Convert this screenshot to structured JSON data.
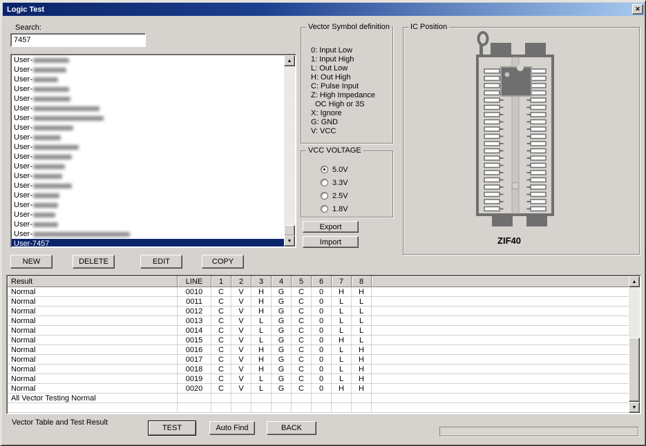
{
  "window": {
    "title": "Logic Test"
  },
  "icons": {
    "close": "✕",
    "scroll_up": "▲",
    "scroll_down": "▼"
  },
  "search": {
    "label": "Search:",
    "value": "7457"
  },
  "device_list": {
    "items": [
      {
        "label": "User-",
        "redacted": true,
        "blur_width": 52
      },
      {
        "label": "User-",
        "redacted": true,
        "blur_width": 48
      },
      {
        "label": "User-",
        "redacted": true,
        "blur_width": 36
      },
      {
        "label": "User-",
        "redacted": true,
        "blur_width": 52
      },
      {
        "label": "User-",
        "redacted": true,
        "blur_width": 54
      },
      {
        "label": "User-",
        "redacted": true,
        "blur_width": 96
      },
      {
        "label": "User-",
        "redacted": true,
        "blur_width": 102
      },
      {
        "label": "User-",
        "redacted": true,
        "blur_width": 58
      },
      {
        "label": "User-",
        "redacted": true,
        "blur_width": 40
      },
      {
        "label": "User-",
        "redacted": true,
        "blur_width": 66
      },
      {
        "label": "User-",
        "redacted": true,
        "blur_width": 56
      },
      {
        "label": "User-",
        "redacted": true,
        "blur_width": 46
      },
      {
        "label": "User-",
        "redacted": true,
        "blur_width": 42
      },
      {
        "label": "User-",
        "redacted": true,
        "blur_width": 56
      },
      {
        "label": "User-",
        "redacted": true,
        "blur_width": 38
      },
      {
        "label": "User-",
        "redacted": true,
        "blur_width": 36
      },
      {
        "label": "User-",
        "redacted": true,
        "blur_width": 32
      },
      {
        "label": "User-",
        "redacted": true,
        "blur_width": 36
      },
      {
        "label": "User-",
        "redacted": true,
        "blur_width": 140
      },
      {
        "label": "User-7457",
        "redacted": false,
        "selected": true
      }
    ]
  },
  "list_actions": {
    "new": "NEW",
    "delete": "DELETE",
    "edit": "EDIT",
    "copy": "COPY"
  },
  "vector_symbols": {
    "title": "Vector Symbol definition",
    "lines": [
      "0: Input Low",
      "1: Input High",
      "L: Out Low",
      "H: Out High",
      "C: Pulse Input",
      "Z: High Impedance",
      "  OC High or 3S",
      "X: Ignore",
      "G: GND",
      "V: VCC"
    ]
  },
  "vcc_voltage": {
    "title": "VCC VOLTAGE",
    "options": [
      {
        "label": "5.0V",
        "selected": true
      },
      {
        "label": "3.3V",
        "selected": false
      },
      {
        "label": "2.5V",
        "selected": false
      },
      {
        "label": "1.8V",
        "selected": false
      }
    ]
  },
  "transfer": {
    "export": "Export",
    "import": "Import"
  },
  "ic_position": {
    "title": "IC Position",
    "socket": "ZIF40"
  },
  "result_table": {
    "headers": [
      "Result",
      "LINE",
      "1",
      "2",
      "3",
      "4",
      "5",
      "6",
      "7",
      "8"
    ],
    "rows": [
      {
        "result": "Normal",
        "line": "0010",
        "values": [
          "C",
          "V",
          "H",
          "G",
          "C",
          "0",
          "H",
          "H"
        ]
      },
      {
        "result": "Normal",
        "line": "0011",
        "values": [
          "C",
          "V",
          "H",
          "G",
          "C",
          "0",
          "L",
          "L"
        ]
      },
      {
        "result": "Normal",
        "line": "0012",
        "values": [
          "C",
          "V",
          "H",
          "G",
          "C",
          "0",
          "L",
          "L"
        ]
      },
      {
        "result": "Normal",
        "line": "0013",
        "values": [
          "C",
          "V",
          "L",
          "G",
          "C",
          "0",
          "L",
          "L"
        ]
      },
      {
        "result": "Normal",
        "line": "0014",
        "values": [
          "C",
          "V",
          "L",
          "G",
          "C",
          "0",
          "L",
          "L"
        ]
      },
      {
        "result": "Normal",
        "line": "0015",
        "values": [
          "C",
          "V",
          "L",
          "G",
          "C",
          "0",
          "H",
          "L"
        ]
      },
      {
        "result": "Normal",
        "line": "0016",
        "values": [
          "C",
          "V",
          "H",
          "G",
          "C",
          "0",
          "L",
          "H"
        ]
      },
      {
        "result": "Normal",
        "line": "0017",
        "values": [
          "C",
          "V",
          "H",
          "G",
          "C",
          "0",
          "L",
          "H"
        ]
      },
      {
        "result": "Normal",
        "line": "0018",
        "values": [
          "C",
          "V",
          "H",
          "G",
          "C",
          "0",
          "L",
          "H"
        ]
      },
      {
        "result": "Normal",
        "line": "0019",
        "values": [
          "C",
          "V",
          "L",
          "G",
          "C",
          "0",
          "L",
          "H"
        ]
      },
      {
        "result": "Normal",
        "line": "0020",
        "values": [
          "C",
          "V",
          "L",
          "G",
          "C",
          "0",
          "H",
          "H"
        ]
      }
    ],
    "summary": "All Vector Testing Normal"
  },
  "footer": {
    "label": "Vector Table and Test Result",
    "test": "TEST",
    "auto_find": "Auto Find",
    "back": "BACK"
  }
}
